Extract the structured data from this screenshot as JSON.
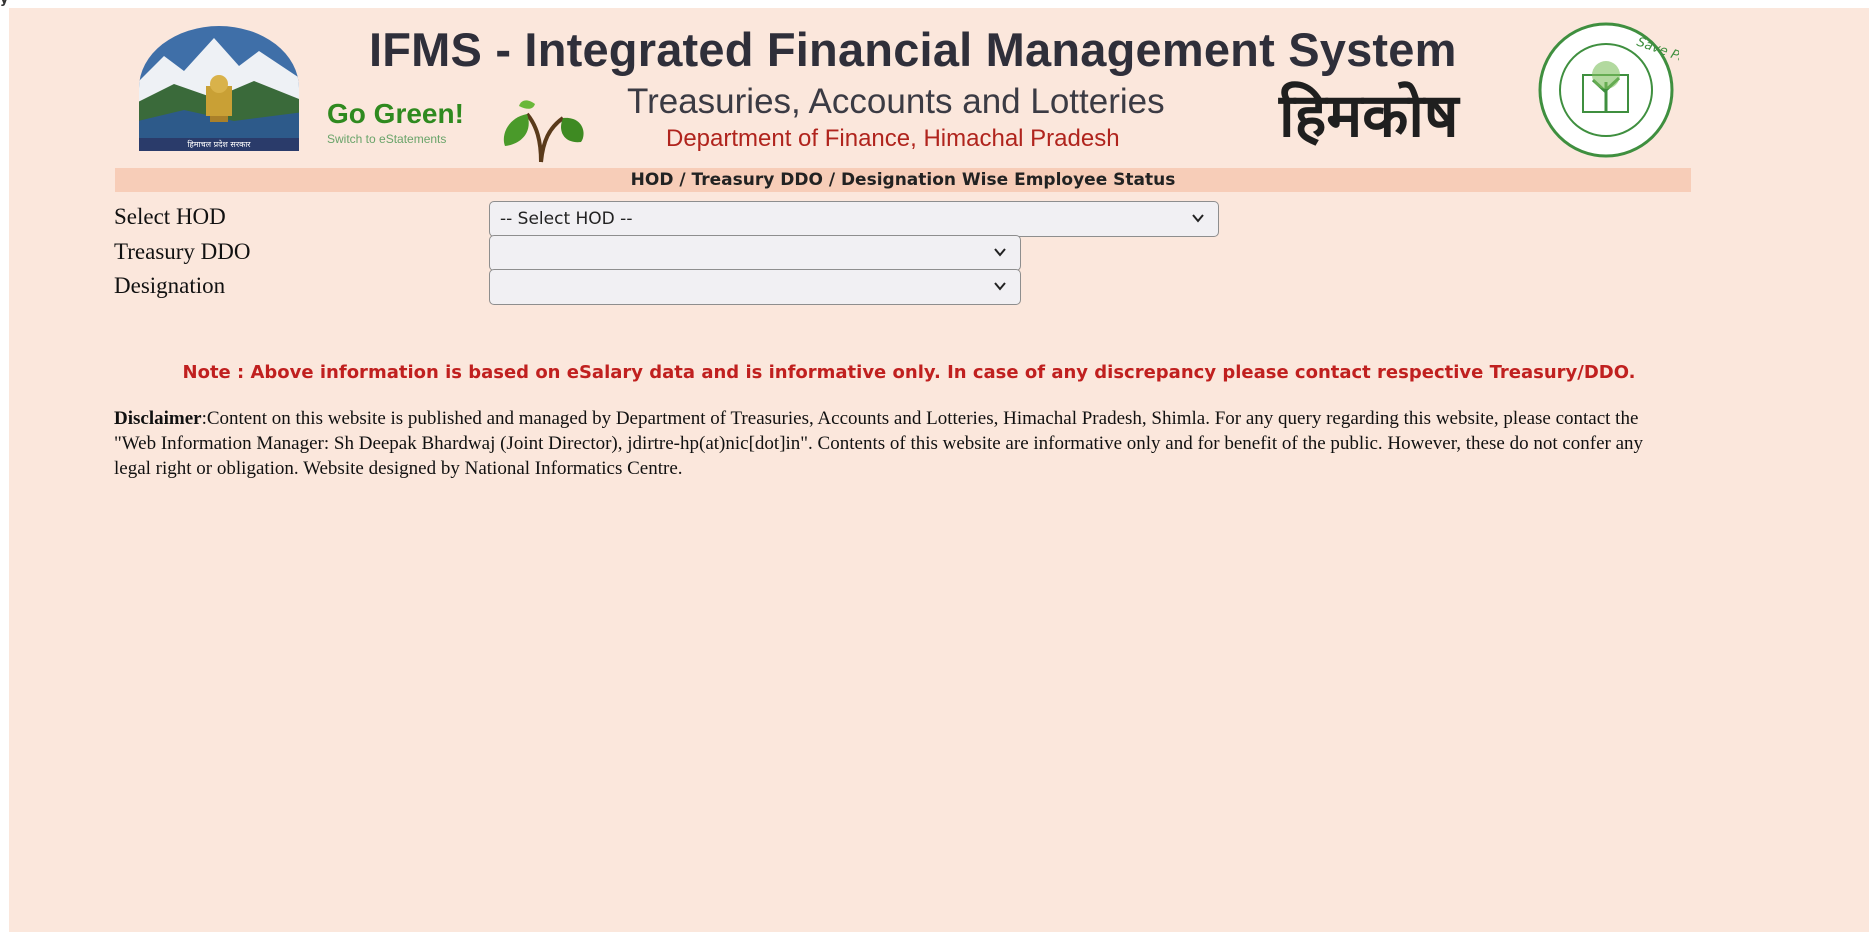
{
  "corner_mark": "y",
  "header": {
    "title": "IFMS - Integrated Financial Management System",
    "subtitle": "Treasuries, Accounts and Lotteries",
    "department": "Department of Finance, Himachal Pradesh",
    "hindi_brand": "हिमकोष",
    "go_green": "Go Green!",
    "go_green_sub": "Switch to eStatements",
    "emblem_text": "हिमाचल प्रदेश सरकार",
    "save_paper_text": "Save Paper"
  },
  "section_title": "HOD / Treasury DDO / Designation Wise Employee Status",
  "form": {
    "hod": {
      "label": "Select HOD",
      "value": "-- Select HOD --"
    },
    "treasury_ddo": {
      "label": "Treasury DDO",
      "value": ""
    },
    "designation": {
      "label": "Designation",
      "value": ""
    }
  },
  "note": "Note : Above information is based on eSalary data and is informative only. In case of any discrepancy please contact respective Treasury/DDO.",
  "disclaimer": {
    "label": "Disclaimer",
    "text": ":Content on this website is published and managed by Department of Treasuries, Accounts and Lotteries, Himachal Pradesh, Shimla. For any query regarding this website, please contact the \"Web Information Manager: Sh Deepak Bhardwaj (Joint Director), jdirtre-hp(at)nic[dot]in\". Contents of this website are informative only and for benefit of the public. However, these do not confer any legal right or obligation. Website designed by National Informatics Centre."
  },
  "colors": {
    "page_bg": "#fbe7dc",
    "section_bar_bg": "#f7cdb8",
    "note_red": "#c0201f",
    "dept_red": "#b0241d",
    "go_green": "#2f8a1f"
  },
  "icons": [
    "state-emblem-icon",
    "leaf-icon",
    "save-paper-seal-icon",
    "chevron-down-icon"
  ]
}
